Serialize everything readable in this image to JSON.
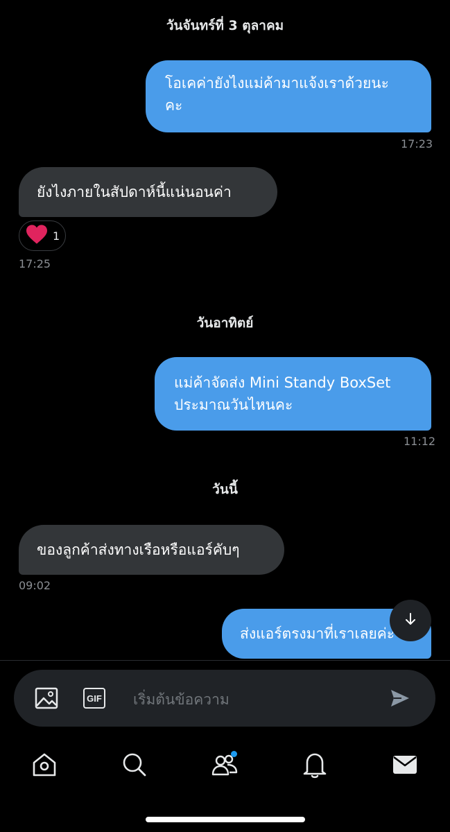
{
  "conversation": {
    "date_1": "วันจันทร์ที่ 3 ตุลาคม",
    "date_2": "วันอาทิตย์",
    "date_3": "วันนี้",
    "messages": [
      {
        "direction": "outgoing",
        "text_line1": "โอเคค่ายังไงแม่ค้ามาแจ้งเราด้วยนะ",
        "text_line2": "คะ",
        "time": "17:23"
      },
      {
        "direction": "incoming",
        "text": "ยังไงภายในสัปดาห์นี้แน่นอนค่า",
        "time": "17:25",
        "reaction": {
          "emoji": "heart",
          "count": "1"
        }
      },
      {
        "direction": "outgoing",
        "text_line1": "แม่ค้าจัดส่ง Mini Standy BoxSet",
        "text_line2": "ประมาณวันไหนคะ",
        "time": "11:12"
      },
      {
        "direction": "incoming",
        "text": "ของลูกค้าส่งทางเรือหรือแอร์คับๆ",
        "time": "09:02"
      },
      {
        "direction": "outgoing",
        "text": "ส่งแอร์ตรงมาที่เราเลยค่ะ"
      }
    ]
  },
  "composer": {
    "placeholder": "เริ่มต้นข้อความ",
    "image_icon": "image-icon",
    "gif_label": "GIF",
    "send_icon": "send-icon"
  },
  "tabbar": {
    "items": [
      "home-icon",
      "search-icon",
      "communities-icon",
      "notifications-icon",
      "messages-icon"
    ],
    "communities_badge": true
  },
  "colors": {
    "background": "#000000",
    "outgoing_bubble": "#4a9cea",
    "incoming_bubble": "#333639",
    "timestamp": "#8b8f94",
    "accent": "#1d9bf0",
    "heart": "#e0245e"
  }
}
